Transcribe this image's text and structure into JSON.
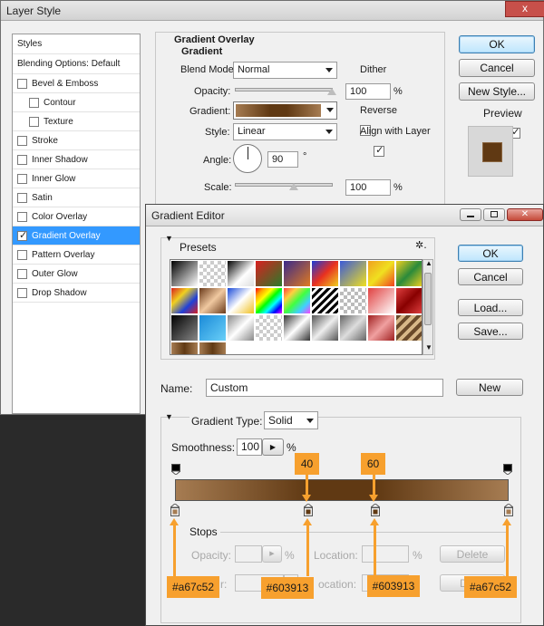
{
  "layer_style": {
    "title": "Layer Style",
    "close": "x",
    "styles_header": "Styles",
    "blending": "Blending Options: Default",
    "items": [
      {
        "label": "Bevel & Emboss",
        "checked": false,
        "sub": false
      },
      {
        "label": "Contour",
        "checked": false,
        "sub": true
      },
      {
        "label": "Texture",
        "checked": false,
        "sub": true
      },
      {
        "label": "Stroke",
        "checked": false,
        "sub": false
      },
      {
        "label": "Inner Shadow",
        "checked": false,
        "sub": false
      },
      {
        "label": "Inner Glow",
        "checked": false,
        "sub": false
      },
      {
        "label": "Satin",
        "checked": false,
        "sub": false
      },
      {
        "label": "Color Overlay",
        "checked": false,
        "sub": false
      },
      {
        "label": "Gradient Overlay",
        "checked": true,
        "sub": false,
        "selected": true
      },
      {
        "label": "Pattern Overlay",
        "checked": false,
        "sub": false
      },
      {
        "label": "Outer Glow",
        "checked": false,
        "sub": false
      },
      {
        "label": "Drop Shadow",
        "checked": false,
        "sub": false
      }
    ],
    "group_title": "Gradient Overlay",
    "sub_title": "Gradient",
    "blend_mode_label": "Blend Mode:",
    "blend_mode_value": "Normal",
    "dither_label": "Dither",
    "opacity_label": "Opacity:",
    "opacity_value": "100",
    "percent": "%",
    "gradient_label": "Gradient:",
    "reverse_label": "Reverse",
    "style_label": "Style:",
    "style_value": "Linear",
    "align_label": "Align with Layer",
    "angle_label": "Angle:",
    "angle_value": "90",
    "degree": "°",
    "scale_label": "Scale:",
    "scale_value": "100",
    "ok": "OK",
    "cancel": "Cancel",
    "new_style": "New Style...",
    "preview_label": "Preview"
  },
  "gradient_editor": {
    "title": "Gradient Editor",
    "presets_label": "Presets",
    "gear": "✲.",
    "ok": "OK",
    "cancel": "Cancel",
    "load": "Load...",
    "save": "Save...",
    "name_label": "Name:",
    "name_value": "Custom",
    "new": "New",
    "gradient_type_label": "Gradient Type:",
    "gradient_type_value": "Solid",
    "smoothness_label": "Smoothness:",
    "smoothness_value": "100",
    "percent": "%",
    "stops_label": "Stops",
    "opacity_label": "Opacity:",
    "location_label": "Location:",
    "delete": "Delete",
    "color_label_partial": "r:",
    "location2_label_partial": "ocation:",
    "delete2_partial": "D",
    "colors": {
      "light": "#a67c52",
      "dark": "#603913"
    }
  },
  "annotations": {
    "stop_2_location": "40",
    "stop_3_location": "60",
    "stop_1_color": "#a67c52",
    "stop_2_color": "#603913",
    "stop_3_color": "#603913",
    "stop_4_color": "#a67c52"
  }
}
